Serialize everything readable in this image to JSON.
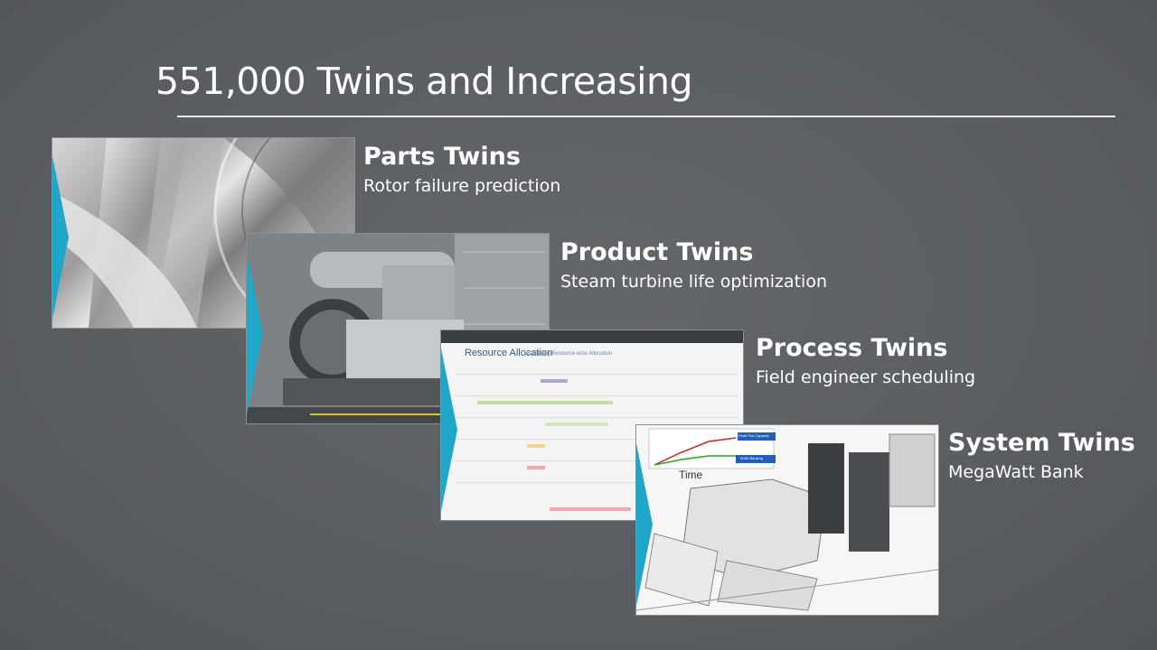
{
  "slide": {
    "title": "551,000 Twins and Increasing"
  },
  "twins": [
    {
      "heading": "Parts Twins",
      "subtitle": "Rotor failure prediction"
    },
    {
      "heading": "Product Twins",
      "subtitle": "Steam turbine life optimization"
    },
    {
      "heading": "Process Twins",
      "subtitle": "Field engineer scheduling"
    },
    {
      "heading": "System Twins",
      "subtitle": "MegaWatt Bank"
    }
  ],
  "process_screen": {
    "app_title": "Resource Allocation",
    "app_subtitle": "Visualizing Resource-wise Allocation"
  },
  "system_screen": {
    "axis_label": "Time",
    "callout_1": "Peak Fire Capacity",
    "callout_2": "MWh Banking"
  },
  "colors": {
    "accent": "#1fa7c9",
    "background": "#5d6064",
    "rule": "#e8e8e8"
  }
}
